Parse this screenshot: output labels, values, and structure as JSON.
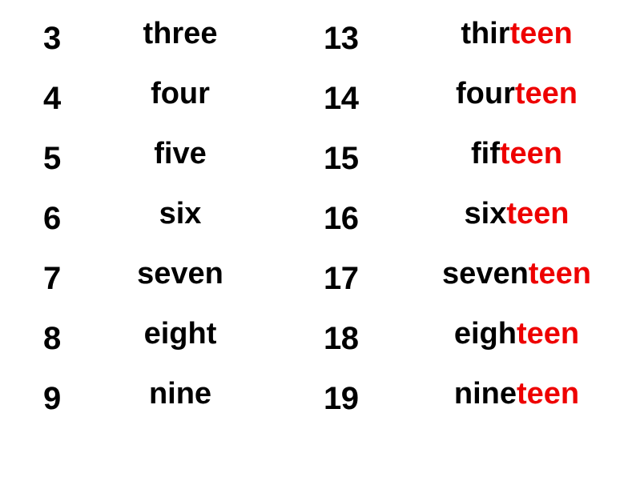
{
  "slide": {
    "background_color": "#ffffff",
    "text_color": "#000000",
    "highlight_color": "#ee0000"
  },
  "columns": {
    "left": {
      "rows": [
        {
          "numeral": "3",
          "stem": "three",
          "suffix": ""
        },
        {
          "numeral": "4",
          "stem": "four",
          "suffix": ""
        },
        {
          "numeral": "5",
          "stem": "five",
          "suffix": ""
        },
        {
          "numeral": "6",
          "stem": "six",
          "suffix": ""
        },
        {
          "numeral": "7",
          "stem": "seven",
          "suffix": ""
        },
        {
          "numeral": "8",
          "stem": "eight",
          "suffix": ""
        },
        {
          "numeral": "9",
          "stem": "nine",
          "suffix": ""
        }
      ]
    },
    "right": {
      "rows": [
        {
          "numeral": "13",
          "stem": "thir",
          "suffix": "teen"
        },
        {
          "numeral": "14",
          "stem": "four",
          "suffix": "teen"
        },
        {
          "numeral": "15",
          "stem": "fif",
          "suffix": "teen"
        },
        {
          "numeral": "16",
          "stem": "six",
          "suffix": "teen"
        },
        {
          "numeral": "17",
          "stem": "seven",
          "suffix": "teen"
        },
        {
          "numeral": "18",
          "stem": "eigh",
          "suffix": "teen"
        },
        {
          "numeral": "19",
          "stem": "nine",
          "suffix": "teen"
        }
      ]
    }
  }
}
